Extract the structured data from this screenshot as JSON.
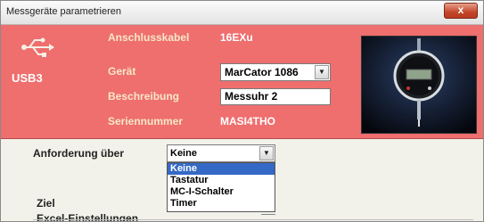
{
  "window": {
    "title": "Messgeräte parametrieren",
    "close_symbol": "x"
  },
  "device_panel": {
    "usb_icon": "usb-icon",
    "port_label": "USB3",
    "fields": {
      "anschlusskabel": {
        "label": "Anschlusskabel",
        "value": "16EXu"
      },
      "geraet": {
        "label": "Gerät",
        "value": "MarCator 1086"
      },
      "beschreibung": {
        "label": "Beschreibung",
        "value": "Messuhr 2"
      },
      "seriennummer": {
        "label": "Seriennummer",
        "value": "MASI4THO"
      }
    }
  },
  "request": {
    "label": "Anforderung über",
    "selected": "Keine",
    "options": [
      "Keine",
      "Tastatur",
      "MC-I-Schalter",
      "Timer"
    ]
  },
  "target": {
    "label": "Ziel"
  },
  "excel": {
    "label": "Excel-Einstellungen"
  },
  "colors": {
    "header_bg": "#ef6e6e",
    "selection": "#3569c6"
  }
}
